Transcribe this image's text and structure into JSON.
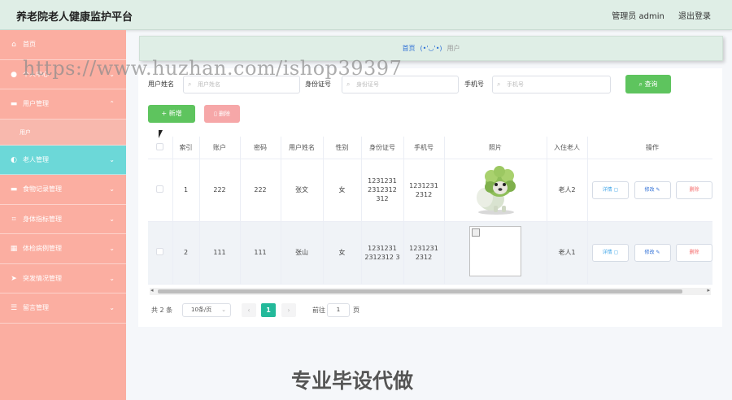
{
  "header": {
    "title": "养老院老人健康监护平台",
    "user": "管理员 admin",
    "logout": "退出登录"
  },
  "sidebar": {
    "items": [
      {
        "label": "首页",
        "icon": "home-icon",
        "glyph": "⌂"
      },
      {
        "label": "个人中心",
        "icon": "user-icon",
        "glyph": "●",
        "chevron": "⌄"
      },
      {
        "label": "用户管理",
        "icon": "monitor-icon",
        "glyph": "▬",
        "chevron": "⌃"
      },
      {
        "label": "老人管理",
        "icon": "dashboard-icon",
        "glyph": "◐",
        "chevron": "⌄"
      },
      {
        "label": "食物记录管理",
        "icon": "monitor-icon",
        "glyph": "▬",
        "chevron": "⌄"
      },
      {
        "label": "身体指标管理",
        "icon": "crop-icon",
        "glyph": "⌗",
        "chevron": "⌄"
      },
      {
        "label": "体检病例管理",
        "icon": "grid-icon",
        "glyph": "▦",
        "chevron": "⌄"
      },
      {
        "label": "突发情况管理",
        "icon": "send-icon",
        "glyph": "➤",
        "chevron": "⌄"
      },
      {
        "label": "留言管理",
        "icon": "list-icon",
        "glyph": "☰",
        "chevron": "⌄"
      }
    ],
    "submenu": "用户"
  },
  "breadcrumb": {
    "home": "首页",
    "emoticon": "(•'◡'•)",
    "current": "用户"
  },
  "watermark": {
    "top": "https://www.huzhan.com/ishop39397",
    "bottom": "专业毕设代做"
  },
  "search": {
    "name_label": "用户姓名",
    "name_placeholder": "用户姓名",
    "id_label": "身份证号",
    "id_placeholder": "身份证号",
    "phone_label": "手机号",
    "phone_placeholder": "手机号",
    "query_button": "查询"
  },
  "actions": {
    "add": "+ 新增",
    "delete": "删除"
  },
  "table": {
    "columns": [
      "",
      "索引",
      "账户",
      "密码",
      "用户姓名",
      "性别",
      "身份证号",
      "手机号",
      "照片",
      "入住老人",
      "操作"
    ],
    "rows": [
      {
        "index": "1",
        "account": "222",
        "password": "222",
        "name": "张文",
        "gender": "女",
        "id_no": "1231231 2312312 312",
        "phone": "1231231 2312",
        "photo": "cabbage-dog-image",
        "elder": "老人2"
      },
      {
        "index": "2",
        "account": "111",
        "password": "111",
        "name": "张山",
        "gender": "女",
        "id_no": "1231231 2312312 3",
        "phone": "1231231 2312",
        "photo": "broken-image",
        "elder": "老人1"
      }
    ],
    "ops": {
      "detail": "详情",
      "edit": "修改",
      "remove": "删除"
    }
  },
  "pagination": {
    "total": "共 2 条",
    "page_size": "10条/页",
    "current_page": "1",
    "goto_label": "前往",
    "goto_value": "1",
    "page_suffix": "页"
  }
}
